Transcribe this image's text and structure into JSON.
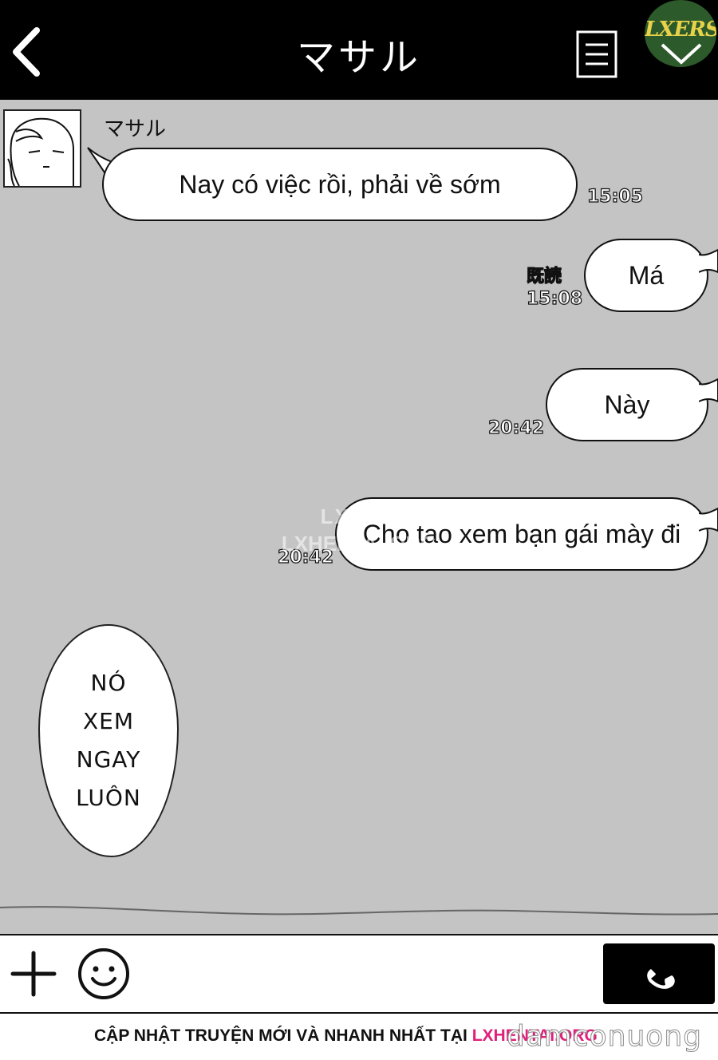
{
  "header": {
    "title": "マサル",
    "logo_text": "LXERS"
  },
  "chat": {
    "sender_name": "マサル",
    "messages": [
      {
        "direction": "in",
        "text": "Nay có việc rồi, phải về sớm",
        "time": "15:05"
      },
      {
        "direction": "out",
        "text": "Má",
        "read": "既読",
        "time": "15:08"
      },
      {
        "direction": "out",
        "text": "Này",
        "time": "20:42"
      },
      {
        "direction": "out",
        "text": "Cho tao xem bạn gái mày đi",
        "time": "20:42"
      }
    ],
    "watermark": [
      "LXERS",
      "LXHENTAI.ORG"
    ],
    "thought_lines": [
      "NÓ",
      "XEM",
      "NGAY",
      "LUÔN"
    ]
  },
  "footer": {
    "text": "CẬP NHẬT TRUYỆN MỚI VÀ NHANH NHẤT TẠI",
    "link": "LXHENTAI.ORG",
    "brand": "damconuong"
  },
  "colors": {
    "header_bg": "#000000",
    "chat_bg": "#c4c4c4",
    "bubble_bg": "#ffffff",
    "footer_link": "#e0207a",
    "logo_bg": "#2d5a2a"
  },
  "icons": {
    "back": "chevron-left-icon",
    "menu": "menu-icon",
    "logo_arrow": "chevron-down-icon",
    "plus": "plus-icon",
    "emoji": "smiley-icon",
    "call": "phone-icon"
  }
}
